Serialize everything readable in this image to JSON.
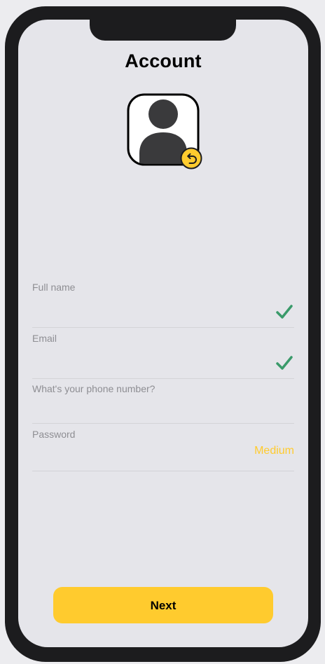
{
  "header": {
    "title": "Account"
  },
  "avatar": {
    "icon": "user-silhouette-icon",
    "badge_icon": "undo-icon",
    "badge_color": "#ffcb2e"
  },
  "form": {
    "full_name": {
      "label": "Full name",
      "value": "",
      "valid": true
    },
    "email": {
      "label": "Email",
      "value": "",
      "valid": true
    },
    "phone": {
      "label": "What's your phone number?",
      "value": ""
    },
    "password": {
      "label": "Password",
      "value": "",
      "strength": "Medium"
    }
  },
  "footer": {
    "next_label": "Next"
  },
  "colors": {
    "accent": "#ffcb2e",
    "check": "#3a9a6a",
    "background": "#e5e5ea"
  }
}
